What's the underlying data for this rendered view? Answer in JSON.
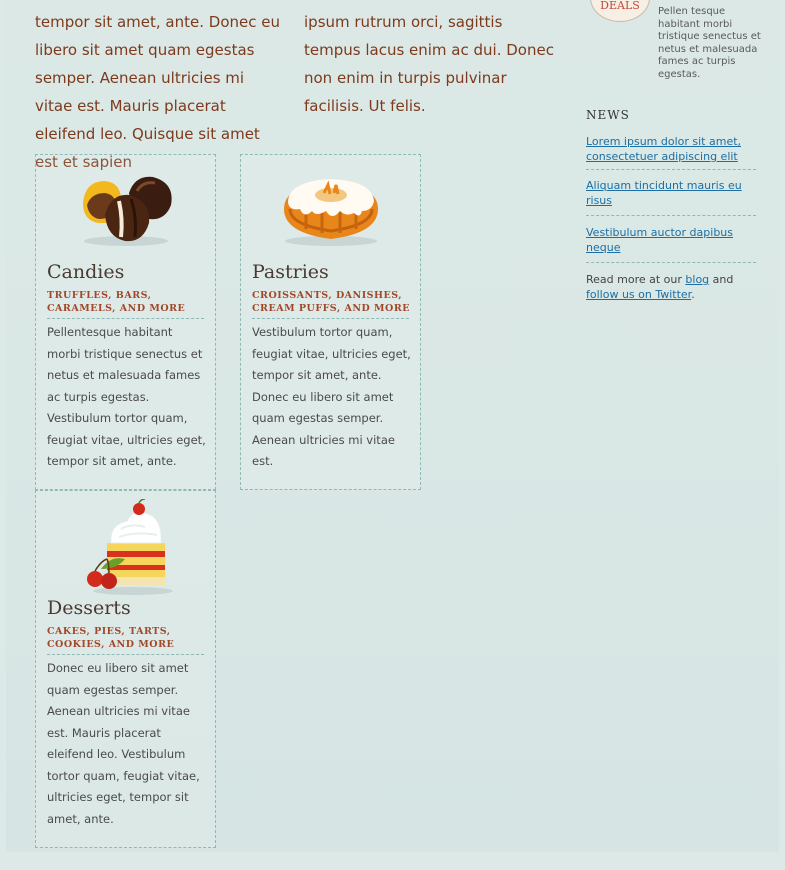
{
  "intro": {
    "col1": "tempor sit amet, ante. Donec eu libero sit amet quam egestas semper. Aenean ultricies mi vitae est. Mauris placerat eleifend leo. Quisque sit amet est et sapien",
    "col2": "ipsum rutrum orci, sagittis tempus lacus enim ac dui. Donec non enim in turpis pulvinar facilisis. Ut felis."
  },
  "cards": [
    {
      "icon": "chocolate-candies-icon",
      "title": "Candies",
      "subtitle": "TRUFFLES, BARS, CARAMELS, AND MORE",
      "body": "Pellentesque habitant morbi tristique senectus et netus et malesuada fames ac turpis egestas. Vestibulum tortor quam, feugiat vitae, ultricies eget, tempor sit amet, ante."
    },
    {
      "icon": "bundt-cake-icon",
      "title": "Pastries",
      "subtitle": "CROISSANTS, DANISHES, CREAM PUFFS, AND MORE",
      "body": "Vestibulum tortor quam, feugiat vitae, ultricies eget, tempor sit amet, ante. Donec eu libero sit amet quam egestas semper. Aenean ultricies mi vitae est."
    },
    {
      "icon": "layer-cake-slice-icon",
      "title": "Desserts",
      "subtitle": "CAKES, PIES, TARTS, COOKIES, AND MORE",
      "body": "Donec eu libero sit amet quam egestas semper. Aenean ultricies mi vitae est. Mauris placerat eleifend leo. Vestibulum tortor quam, feugiat vitae, ultricies eget, tempor sit amet, ante."
    }
  ],
  "sidebar": {
    "deals_badge": "DEALS",
    "deals_text": "Pellen tesque habitant morbi tristique senectus et netus et malesuada fames ac turpis egestas.",
    "news_heading": "NEWS",
    "news_items": [
      "Lorem ipsum dolor sit amet, consectetuer adipiscing elit",
      "Aliquam tincidunt mauris eu risus",
      "Vestibulum auctor dapibus neque"
    ],
    "readmore_prefix": "Read more at our",
    "readmore_blog": "blog",
    "readmore_and": "and",
    "readmore_twitter": "follow us on Twitter",
    "readmore_suffix": "."
  },
  "colors": {
    "background": "#dce9e7",
    "text_brown": "#7d3a1d",
    "subtitle_red": "#a2482a",
    "link_blue": "#1d6fa3",
    "dashed_border": "#8fb9b4"
  }
}
